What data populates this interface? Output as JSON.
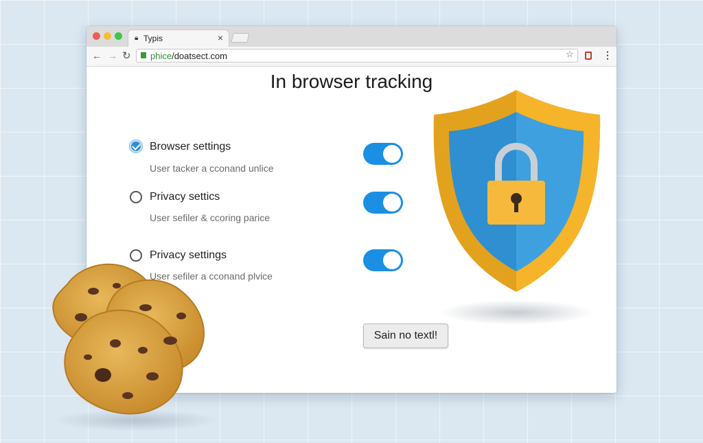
{
  "browser": {
    "tab_title": "Typis",
    "tab_close": "×",
    "url_protocol": "phice",
    "url_rest": "/doatsect.com"
  },
  "page": {
    "heading": "In browser tracking",
    "options": [
      {
        "label": "Browser settings",
        "description": "User tacker a cconand unlice",
        "checked": true,
        "toggle_on": true
      },
      {
        "label": "Privacy settics",
        "description": "User sefiler & ccoring parice",
        "checked": false,
        "toggle_on": true
      },
      {
        "label": "Privacy settings",
        "description": "User sefiler a cconand plvice",
        "checked": false,
        "toggle_on": true
      }
    ],
    "action_button": "Sain no textl!"
  },
  "colors": {
    "toggle_on": "#1a8fe3",
    "shield_gold": "#f5b42a",
    "shield_blue": "#2f8fd0",
    "checkbox_blue": "#2f8fd8"
  },
  "icons": {
    "tab": "lock-icon",
    "nav": [
      "back-arrow-icon",
      "forward-arrow-icon",
      "reload-icon"
    ],
    "address": "secure-lock-icon",
    "toolbar_right": [
      "bookmark-star-icon",
      "extension-icon",
      "menu-icon"
    ],
    "illustration": [
      "shield-padlock-icon",
      "cookies-icon"
    ]
  }
}
